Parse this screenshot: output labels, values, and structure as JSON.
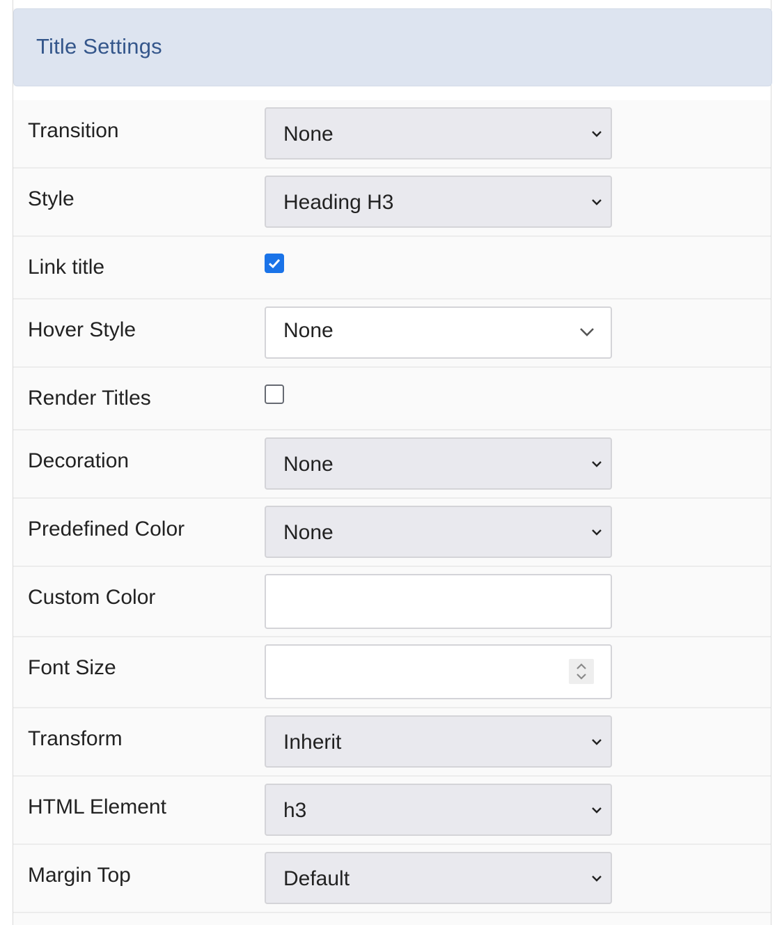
{
  "header": {
    "title": "Title Settings"
  },
  "fields": {
    "transition": {
      "label": "Transition",
      "value": "None"
    },
    "style": {
      "label": "Style",
      "value": "Heading H3"
    },
    "link_title": {
      "label": "Link title",
      "checked": true
    },
    "hover_style": {
      "label": "Hover Style",
      "value": "None"
    },
    "render_titles": {
      "label": "Render Titles",
      "checked": false
    },
    "decoration": {
      "label": "Decoration",
      "value": "None"
    },
    "predefined_color": {
      "label": "Predefined Color",
      "value": "None"
    },
    "custom_color": {
      "label": "Custom Color",
      "value": ""
    },
    "font_size": {
      "label": "Font Size",
      "value": ""
    },
    "transform": {
      "label": "Transform",
      "value": "Inherit"
    },
    "html_element": {
      "label": "HTML Element",
      "value": "h3"
    },
    "margin_top": {
      "label": "Margin Top",
      "value": "Default"
    }
  },
  "colors": {
    "accent": "#1a73e8",
    "header_bg": "#dde4f0",
    "header_text": "#34568b"
  },
  "icons": [
    "chevron-down-icon",
    "check-icon",
    "spinner-arrows-icon"
  ]
}
